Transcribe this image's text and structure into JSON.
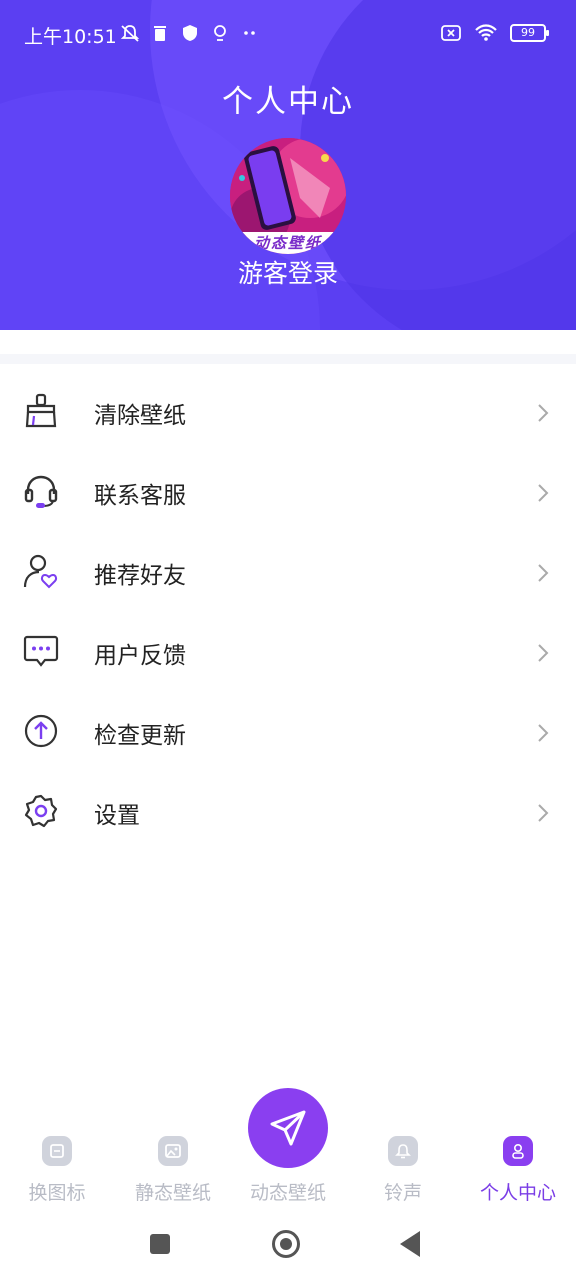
{
  "status_bar": {
    "time": "上午10:51",
    "battery": "99"
  },
  "header": {
    "title": "个人中心",
    "avatar_caption": "动态壁纸",
    "login_label": "游客登录"
  },
  "menu": {
    "items": [
      {
        "label": "清除壁纸",
        "icon": "broom-icon"
      },
      {
        "label": "联系客服",
        "icon": "headset-icon"
      },
      {
        "label": "推荐好友",
        "icon": "user-heart-icon"
      },
      {
        "label": "用户反馈",
        "icon": "chat-bubble-icon"
      },
      {
        "label": "检查更新",
        "icon": "arrow-up-circle-icon"
      },
      {
        "label": "设置",
        "icon": "gear-icon"
      }
    ]
  },
  "bottom_nav": {
    "items": [
      {
        "label": "换图标",
        "icon": "swap-icon"
      },
      {
        "label": "静态壁纸",
        "icon": "image-icon"
      },
      {
        "label": "动态壁纸",
        "icon": "send-icon"
      },
      {
        "label": "铃声",
        "icon": "bell-icon"
      },
      {
        "label": "个人中心",
        "icon": "user-icon"
      }
    ],
    "active_index": 4
  },
  "colors": {
    "accent": "#8a3ff0",
    "header_bg": "#5b3ff2",
    "inactive": "#b9bcc6"
  }
}
